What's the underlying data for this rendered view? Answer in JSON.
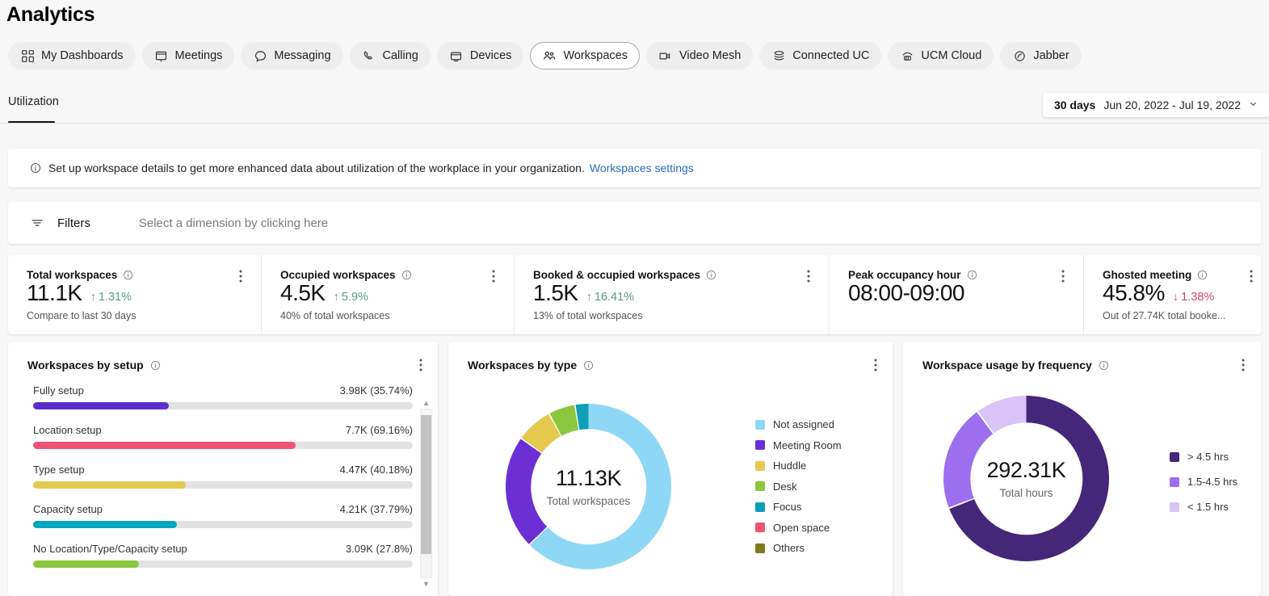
{
  "header": {
    "title": "Analytics",
    "tabs": [
      {
        "label": "My Dashboards",
        "icon": "dashboard-grid-icon",
        "active": false
      },
      {
        "label": "Meetings",
        "icon": "meetings-board-icon",
        "active": false
      },
      {
        "label": "Messaging",
        "icon": "message-bubble-icon",
        "active": false
      },
      {
        "label": "Calling",
        "icon": "phone-handset-icon",
        "active": false
      },
      {
        "label": "Devices",
        "icon": "device-monitor-icon",
        "active": false
      },
      {
        "label": "Workspaces",
        "icon": "workspaces-people-icon",
        "active": true
      },
      {
        "label": "Video Mesh",
        "icon": "video-camera-icon",
        "active": false
      },
      {
        "label": "Connected UC",
        "icon": "stacked-layers-icon",
        "active": false
      },
      {
        "label": "UCM Cloud",
        "icon": "desk-phone-icon",
        "active": false
      },
      {
        "label": "Jabber",
        "icon": "jabber-swirl-icon",
        "active": false
      }
    ]
  },
  "subnav": {
    "tab_label": "Utilization",
    "date_range": {
      "days_label": "30 days",
      "range": "Jun 20, 2022 - Jul 19, 2022",
      "chevron": "chevron-down-icon"
    }
  },
  "banner": {
    "text": "Set up workspace details to get more enhanced data about utilization of the workplace in your organization.",
    "link": "Workspaces settings"
  },
  "filters": {
    "label": "Filters",
    "placeholder": "Select a dimension by clicking here"
  },
  "kpis": [
    {
      "title": "Total workspaces",
      "value": "11.1K",
      "delta": "1.31%",
      "delta_dir": "up",
      "sub": "Compare to last 30 days"
    },
    {
      "title": "Occupied workspaces",
      "value": "4.5K",
      "delta": "5.9%",
      "delta_dir": "up",
      "sub": "40% of total workspaces"
    },
    {
      "title": "Booked & occupied workspaces",
      "value": "1.5K",
      "delta": "16.41%",
      "delta_dir": "up",
      "sub": "13% of total workspaces"
    },
    {
      "title": "Peak occupancy hour",
      "value": "08:00-09:00",
      "delta": "",
      "delta_dir": "none",
      "sub": ""
    },
    {
      "title": "Ghosted meeting",
      "value": "45.8%",
      "delta": "1.38%",
      "delta_dir": "down",
      "sub": "Out of 27.74K total booke..."
    }
  ],
  "cards": {
    "setup": {
      "title": "Workspaces by setup"
    },
    "type": {
      "title": "Workspaces by type"
    },
    "frequency": {
      "title": "Workspace usage by frequency"
    }
  },
  "colors": {
    "accent_link": "#2a6ebb",
    "up": "#5c9b80",
    "down": "#d04a6a",
    "track": "#e2e2e2"
  },
  "chart_data": [
    {
      "type": "bar",
      "title": "Workspaces by setup",
      "orientation": "horizontal",
      "xlabel": "",
      "ylabel": "",
      "categories": [
        "Fully setup",
        "Location setup",
        "Type setup",
        "Capacity setup",
        "No Location/Type/Capacity setup"
      ],
      "values": [
        3980,
        7700,
        4470,
        4210,
        3090
      ],
      "value_labels": [
        "3.98K (35.74%)",
        "7.7K (69.16%)",
        "4.47K (40.18%)",
        "4.21K (37.79%)",
        "3.09K (27.8%)"
      ],
      "percents": [
        35.74,
        69.16,
        40.18,
        37.79,
        27.8
      ],
      "bar_colors": [
        "#5b2ecc",
        "#ee5374",
        "#e5c94f",
        "#00a6c0",
        "#8cc63e"
      ],
      "track_color": "#e2e2e2",
      "ylim": [
        0,
        100
      ],
      "grid": false,
      "legend": "none"
    },
    {
      "type": "pie",
      "variant": "donut",
      "title": "Workspaces by type",
      "center_value": "11.13K",
      "center_label": "Total workspaces",
      "legend_position": "right",
      "categories": [
        "Not assigned",
        "Meeting Room",
        "Huddle",
        "Desk",
        "Focus",
        "Open space",
        "Others"
      ],
      "values": [
        62.5,
        22.0,
        7.0,
        5.0,
        2.5,
        0.7,
        0.3
      ],
      "colors": [
        "#8fd8f5",
        "#6c2fd4",
        "#e5c94f",
        "#8cc63e",
        "#0e9fb5",
        "#ee5374",
        "#7d7a1f"
      ]
    },
    {
      "type": "pie",
      "variant": "donut",
      "title": "Workspace usage by frequency",
      "center_value": "292.31K",
      "center_label": "Total hours",
      "legend_position": "right",
      "categories": [
        "> 4.5 hrs",
        "1.5-4.5 hrs",
        "< 1.5 hrs"
      ],
      "values": [
        69.0,
        20.5,
        10.5
      ],
      "colors": [
        "#45277a",
        "#9d6ff0",
        "#d8c4f7"
      ]
    }
  ]
}
